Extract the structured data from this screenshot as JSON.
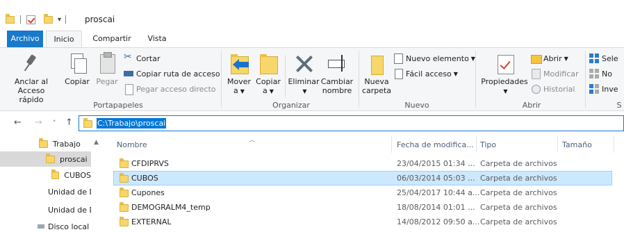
{
  "window": {
    "title": "proscai"
  },
  "ribbon_tabs": [
    "Archivo",
    "Inicio",
    "Compartir",
    "Vista"
  ],
  "ribbon": {
    "clipboard": {
      "pin": "Anclar al\nAcceso rápido",
      "pin_l1": "Anclar al",
      "pin_l2": "Acceso rápido",
      "copy": "Copiar",
      "paste": "Pegar",
      "cut": "Cortar",
      "copy_path": "Copiar ruta de acceso",
      "paste_shortcut": "Pegar acceso directo",
      "group": "Portapapeles"
    },
    "organize": {
      "move_l1": "Mover",
      "move_l2": "a",
      "copy_l1": "Copiar",
      "copy_l2": "a",
      "delete": "Eliminar",
      "rename_l1": "Cambiar",
      "rename_l2": "nombre",
      "group": "Organizar"
    },
    "new": {
      "folder_l1": "Nueva",
      "folder_l2": "carpeta",
      "new_item": "Nuevo elemento",
      "easy_access": "Fácil acceso",
      "group": "Nuevo"
    },
    "open": {
      "properties": "Propiedades",
      "open": "Abrir",
      "edit": "Modificar",
      "history": "Historial",
      "group": "Abrir"
    },
    "select": {
      "select_all": "Sele",
      "select_none": "No",
      "invert": "Inve",
      "group": "S"
    }
  },
  "address": {
    "path": "C:\\Trabajo\\proscai"
  },
  "nav_pane": {
    "items": [
      "Trabajo",
      "proscai",
      "CUBOS",
      "Unidad de D",
      "Unidad de D",
      "Disco local"
    ]
  },
  "file_list": {
    "columns": [
      "Nombre",
      "Fecha de modifica...",
      "Tipo",
      "Tamaño"
    ],
    "rows": [
      {
        "name": "CFDIPRVS",
        "date": "23/04/2015 01:34 ...",
        "type": "Carpeta de archivos"
      },
      {
        "name": "CUBOS",
        "date": "06/03/2014 05:03 ...",
        "type": "Carpeta de archivos"
      },
      {
        "name": "Cupones",
        "date": "25/04/2017 10:44 a...",
        "type": "Carpeta de archivos"
      },
      {
        "name": "DEMOGRALM4_temp",
        "date": "18/08/2014 01:01 ...",
        "type": "Carpeta de archivos"
      },
      {
        "name": "EXTERNAL",
        "date": "14/08/2012 09:50 a...",
        "type": "Carpeta de archivos"
      }
    ]
  },
  "colors": {
    "accent": "#1979ca",
    "selection": "#cce8ff",
    "folder": "#f7d66b"
  }
}
